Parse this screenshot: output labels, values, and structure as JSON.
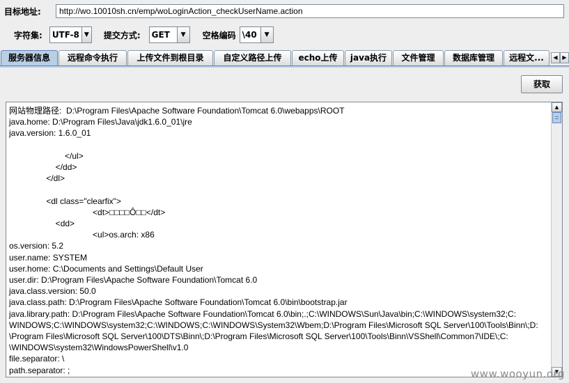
{
  "target": {
    "label": "目标地址:",
    "url": "http://wo.10010sh.cn/emp/woLoginAction_checkUserName.action"
  },
  "options": {
    "charset_label": "字符集:",
    "charset_value": "UTF-8",
    "method_label": "提交方式:",
    "method_value": "GET",
    "space_label": "空格编码",
    "space_value": "\\40"
  },
  "tabs": [
    {
      "label": "服务器信息",
      "active": true
    },
    {
      "label": "远程命令执行"
    },
    {
      "label": "上传文件到根目录"
    },
    {
      "label": "自定义路径上传"
    },
    {
      "label": "echo上传"
    },
    {
      "label": "java执行"
    },
    {
      "label": "文件管理"
    },
    {
      "label": "数据库管理"
    },
    {
      "label": "远程文..."
    }
  ],
  "fetch_button": "获取",
  "output_lines": [
    "网站物理路径:  D:\\Program Files\\Apache Software Foundation\\Tomcat 6.0\\webapps\\ROOT",
    "java.home: D:\\Program Files\\Java\\jdk1.6.0_01\\jre",
    "java.version: 1.6.0_01",
    "",
    "                        </ul>",
    "                    </dd>",
    "                </dl>",
    "",
    "                <dl class=\"clearfix\">",
    "                                    <dt>□□□□Ô□□</dt>",
    "                    <dd>",
    "                                    <ul>os.arch: x86",
    "os.version: 5.2",
    "user.name: SYSTEM",
    "user.home: C:\\Documents and Settings\\Default User",
    "user.dir: D:\\Program Files\\Apache Software Foundation\\Tomcat 6.0",
    "java.class.version: 50.0",
    "java.class.path: D:\\Program Files\\Apache Software Foundation\\Tomcat 6.0\\bin\\bootstrap.jar",
    "java.library.path: D:\\Program Files\\Apache Software Foundation\\Tomcat 6.0\\bin;.;C:\\WINDOWS\\Sun\\Java\\bin;C:\\WINDOWS\\system32;C:",
    "WINDOWS;C:\\WINDOWS\\system32;C:\\WINDOWS;C:\\WINDOWS\\System32\\Wbem;D:\\Program Files\\Microsoft SQL Server\\100\\Tools\\Binn\\;D:",
    "\\Program Files\\Microsoft SQL Server\\100\\DTS\\Binn\\;D:\\Program Files\\Microsoft SQL Server\\100\\Tools\\Binn\\VSShell\\Common7\\IDE\\;C:",
    "\\WINDOWS\\system32\\WindowsPowerShell\\v1.0",
    "file.separator: \\",
    "path.separator: ;"
  ],
  "watermark": "www.wooyun.org",
  "icons": {
    "combo_arrow": "chevron-down-icon",
    "tab_scroll_left": "chevron-left-icon",
    "tab_scroll_right": "chevron-right-icon",
    "scroll_up": "chevron-up-icon",
    "scroll_down": "chevron-down-icon"
  },
  "colors": {
    "active_tab": "#b8cfe5",
    "background": "#eeeeee"
  }
}
